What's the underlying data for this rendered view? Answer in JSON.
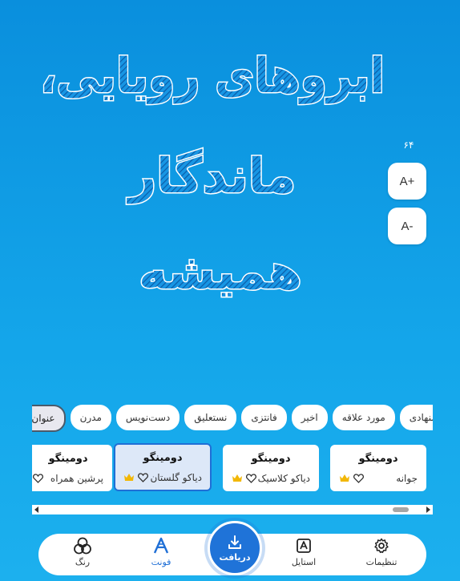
{
  "preview": {
    "lines": [
      "ابروهای رویایی،",
      "ماندگار",
      "همیشه"
    ],
    "size_value": "۶۴",
    "increase_label": "A+",
    "decrease_label": "A-"
  },
  "categories": [
    {
      "label": "پیشنهادی",
      "selected": false
    },
    {
      "label": "مورد علاقه",
      "selected": false
    },
    {
      "label": "اخیر",
      "selected": false
    },
    {
      "label": "فانتزی",
      "selected": false
    },
    {
      "label": "نستعلیق",
      "selected": false
    },
    {
      "label": "دست‌نویس",
      "selected": false
    },
    {
      "label": "مدرن",
      "selected": false
    },
    {
      "label": "عنوان",
      "selected": true
    }
  ],
  "fonts": [
    {
      "sample": "دومینگو",
      "name": "جوانه",
      "premium": true,
      "selected": false
    },
    {
      "sample": "دومینگو",
      "name": "دیاکو کلاسیک",
      "premium": true,
      "selected": false
    },
    {
      "sample": "دومینگو",
      "name": "دیاکو گلستان",
      "premium": true,
      "selected": true
    },
    {
      "sample": "دومینگو",
      "name": "پرشین همراه",
      "premium": false,
      "selected": false
    }
  ],
  "scroll": {
    "position": 0.96
  },
  "nav": {
    "settings": {
      "label": "تنظیمات",
      "icon": "gear-icon"
    },
    "style": {
      "label": "استایل",
      "icon": "style-icon"
    },
    "download": {
      "label": "دریافت",
      "icon": "download-icon"
    },
    "font": {
      "label": "فونت",
      "icon": "font-icon"
    },
    "color": {
      "label": "رنگ",
      "icon": "color-circles-icon"
    }
  },
  "colors": {
    "background_top": "#0a8fdd",
    "background_bottom": "#1cb0ee",
    "accent": "#1f6fd6",
    "premium_crown": "#f2b705"
  }
}
